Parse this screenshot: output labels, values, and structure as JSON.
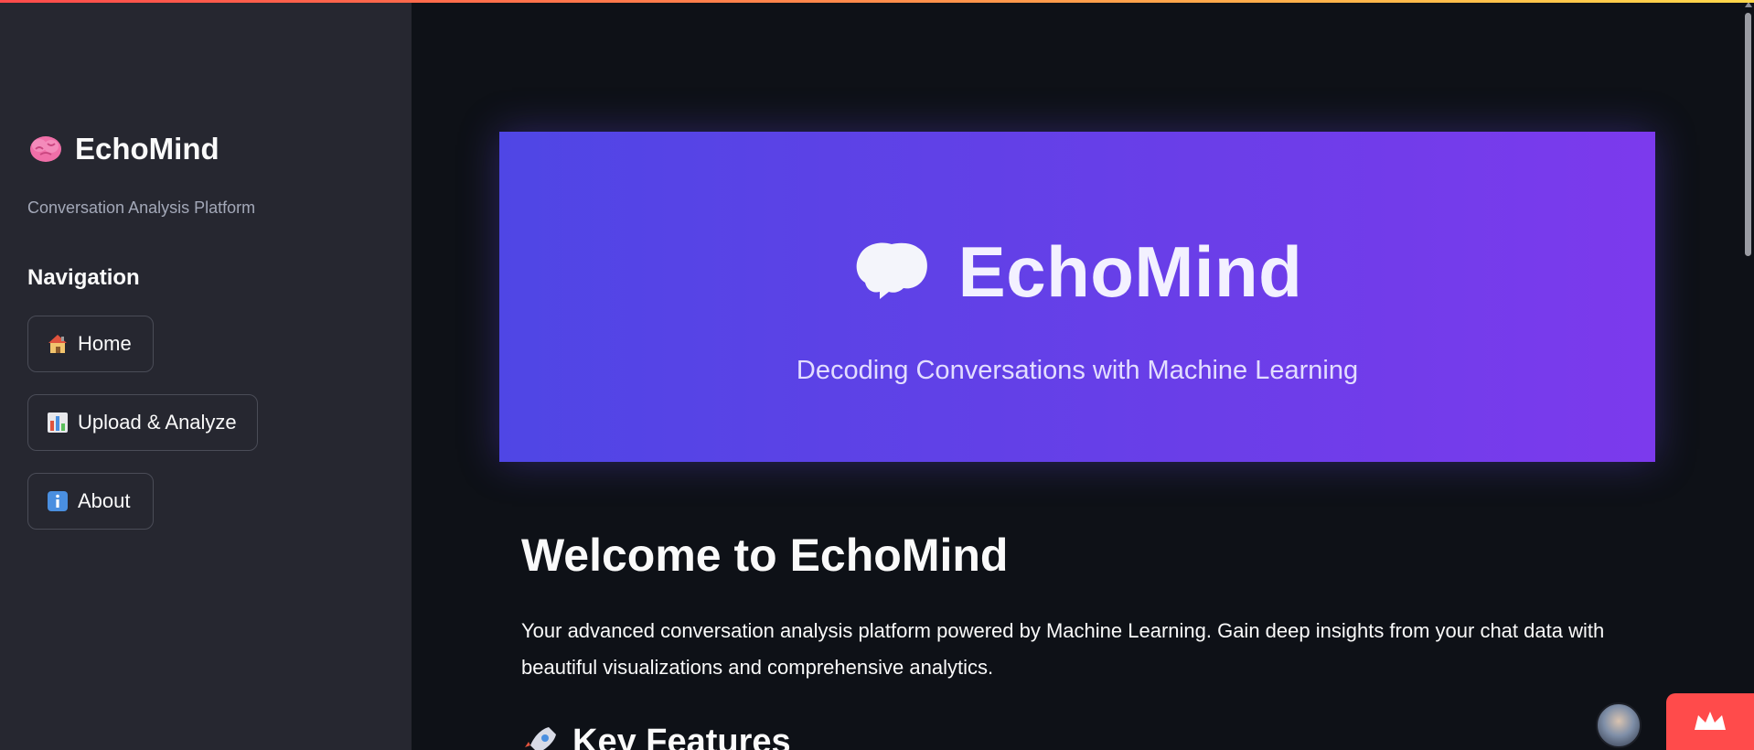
{
  "sidebar": {
    "brand_title": "EchoMind",
    "brand_subtitle": "Conversation Analysis Platform",
    "nav_title": "Navigation",
    "nav_items": [
      {
        "label": "Home",
        "icon": "house-icon"
      },
      {
        "label": "Upload & Analyze",
        "icon": "bar-chart-icon"
      },
      {
        "label": "About",
        "icon": "info-icon"
      }
    ]
  },
  "hero": {
    "title": "EchoMind",
    "subtitle": "Decoding Conversations with Machine Learning",
    "icon": "brain-icon"
  },
  "main": {
    "welcome_title": "Welcome to EchoMind",
    "intro_text": "Your advanced conversation analysis platform powered by Machine Learning. Gain deep insights from your chat data with beautiful visualizations and comprehensive analytics.",
    "features_heading": "Key Features",
    "features_icon": "rocket-icon"
  },
  "colors": {
    "sidebar_bg": "#262730",
    "main_bg": "#0e1117",
    "hero_gradient_start": "#4f46e5",
    "hero_gradient_end": "#7c3aed",
    "accent_red": "#ff4b4b"
  }
}
